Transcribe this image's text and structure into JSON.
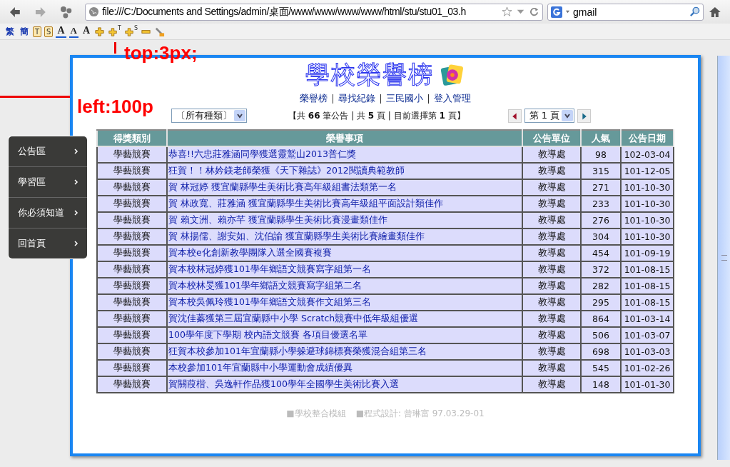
{
  "browser": {
    "address": "file:///C:/Documents and Settings/admin/桌面/www/www/www/www/html/stu/stu01_03.h",
    "search": "gmail"
  },
  "toolbar": [
    {
      "kind": "text",
      "label": "繁"
    },
    {
      "kind": "text",
      "label": "簡"
    },
    {
      "kind": "clip",
      "label": "T"
    },
    {
      "kind": "clip",
      "label": "S"
    },
    {
      "kind": "font-up",
      "label": "A"
    },
    {
      "kind": "font-down",
      "label": "A"
    },
    {
      "kind": "font",
      "label": "A"
    },
    {
      "kind": "plus"
    },
    {
      "kind": "plus-sup",
      "label": "T"
    },
    {
      "kind": "plus-sup",
      "label": "S"
    },
    {
      "kind": "minus"
    },
    {
      "kind": "tool"
    }
  ],
  "annotations": [
    {
      "kind": "top",
      "text": "top:3px;"
    },
    {
      "kind": "left",
      "text": "left:100p"
    }
  ],
  "sidebar": {
    "items": [
      {
        "label": "公告區"
      },
      {
        "label": "學習區"
      },
      {
        "label": "你必須知道"
      },
      {
        "label": "回首頁"
      }
    ]
  },
  "page": {
    "title": "學校榮譽榜",
    "nav": [
      "榮譽榜",
      "尋找紀錄",
      "三民國小",
      "登入管理"
    ],
    "category": "〔所有種類〕",
    "summary": "【共 **66** 筆公告 | 共 **5** 頁 | 目前選擇第 **1** 頁】",
    "page_select": "第 1 頁",
    "table": {
      "columns": [
        "得獎類別",
        "榮譽事項",
        "公告單位",
        "人氣",
        "公告日期"
      ],
      "rows": [
        [
          "學藝競賽",
          "恭喜!!六忠莊雅涵同學獲選靈鷲山2013普仁獎",
          "教導處",
          "98",
          "102-03-04"
        ],
        [
          "學藝競賽",
          "狂賀！！林妗鎂老師榮獲《天下雜誌》2012閱讀典範教師",
          "教導處",
          "315",
          "101-12-05"
        ],
        [
          "學藝競賽",
          "賀 林冠婷 獲宜蘭縣學生美術比賽高年級組書法類第一名",
          "教導處",
          "271",
          "101-10-30"
        ],
        [
          "學藝競賽",
          "賀 林政寬、莊雅涵 獲宜蘭縣學生美術比賽高年級組平面設計類佳作",
          "教導處",
          "233",
          "101-10-30"
        ],
        [
          "學藝競賽",
          "賀 賴文洲、賴亦芊 獲宜蘭縣學生美術比賽漫畫類佳作",
          "教導處",
          "276",
          "101-10-30"
        ],
        [
          "學藝競賽",
          "賀 林揚儒、謝安如、沈伯諭 獲宜蘭縣學生美術比賽繪畫類佳作",
          "教導處",
          "304",
          "101-10-30"
        ],
        [
          "學藝競賽",
          "賀本校e化創新教學團隊入選全國賽複賽",
          "教導處",
          "454",
          "101-09-19"
        ],
        [
          "學藝競賽",
          "賀本校林冠婷獲101學年鄉語文競賽寫字組第一名",
          "教導處",
          "372",
          "101-08-15"
        ],
        [
          "學藝競賽",
          "賀本校林旻獲101學年鄉語文競賽寫字組第二名",
          "教導處",
          "282",
          "101-08-15"
        ],
        [
          "學藝競賽",
          "賀本校吳佩玲獲101學年鄉語文競賽作文組第三名",
          "教導處",
          "295",
          "101-08-15"
        ],
        [
          "學藝競賽",
          "賀沈佳蓁獲第三屆宜蘭縣中小學 Scratch競賽中低年級組優選",
          "教導處",
          "864",
          "101-03-14"
        ],
        [
          "學藝競賽",
          "100學年度下學期 校內語文競賽 各項目優選名單",
          "教導處",
          "506",
          "101-03-07"
        ],
        [
          "學藝競賽",
          "狂賀本校參加101年宜蘭縣小學躲避球錦標賽榮獲混合組第三名",
          "教導處",
          "698",
          "101-03-03"
        ],
        [
          "學藝競賽",
          "本校參加101年宜蘭縣中小學運動會成績優異",
          "教導處",
          "545",
          "101-02-26"
        ],
        [
          "學藝競賽",
          "賀關葭楷、吳逸軒作品獲100學年全國學生美術比賽入選",
          "教導處",
          "148",
          "101-01-30"
        ]
      ]
    },
    "footer": [
      "■學校整合模組",
      "■程式設計: 曾琳富 97.03.29-01"
    ]
  }
}
